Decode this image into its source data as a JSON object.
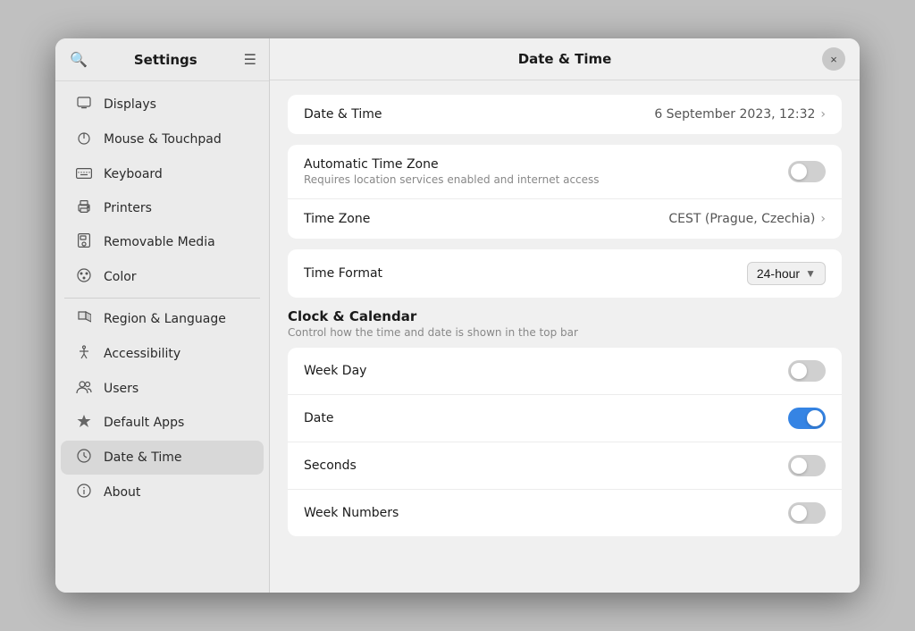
{
  "window": {
    "title": "Date & Time",
    "close_label": "×"
  },
  "sidebar": {
    "title": "Settings",
    "items": [
      {
        "id": "displays",
        "label": "Displays",
        "icon": "🖥"
      },
      {
        "id": "mouse-touchpad",
        "label": "Mouse & Touchpad",
        "icon": "🖱"
      },
      {
        "id": "keyboard",
        "label": "Keyboard",
        "icon": "⌨"
      },
      {
        "id": "printers",
        "label": "Printers",
        "icon": "🖨"
      },
      {
        "id": "removable-media",
        "label": "Removable Media",
        "icon": "💾"
      },
      {
        "id": "color",
        "label": "Color",
        "icon": "🎨"
      },
      {
        "id": "region-language",
        "label": "Region & Language",
        "icon": "🏴"
      },
      {
        "id": "accessibility",
        "label": "Accessibility",
        "icon": "♿"
      },
      {
        "id": "users",
        "label": "Users",
        "icon": "👥"
      },
      {
        "id": "default-apps",
        "label": "Default Apps",
        "icon": "★"
      },
      {
        "id": "date-time",
        "label": "Date & Time",
        "icon": "🕐",
        "active": true
      },
      {
        "id": "about",
        "label": "About",
        "icon": "ℹ"
      }
    ]
  },
  "main": {
    "date_time_row": {
      "label": "Date & Time",
      "value": "6 September 2023, 12:32"
    },
    "auto_timezone": {
      "label": "Automatic Time Zone",
      "sublabel": "Requires location services enabled and internet access",
      "enabled": false
    },
    "timezone_row": {
      "label": "Time Zone",
      "value": "CEST (Prague, Czechia)"
    },
    "time_format": {
      "label": "Time Format",
      "value": "24-hour"
    },
    "clock_calendar": {
      "title": "Clock & Calendar",
      "desc": "Control how the time and date is shown in the top bar"
    },
    "week_day": {
      "label": "Week Day",
      "enabled": false
    },
    "date": {
      "label": "Date",
      "enabled": true
    },
    "seconds": {
      "label": "Seconds",
      "enabled": false
    },
    "week_numbers": {
      "label": "Week Numbers",
      "enabled": false
    }
  }
}
